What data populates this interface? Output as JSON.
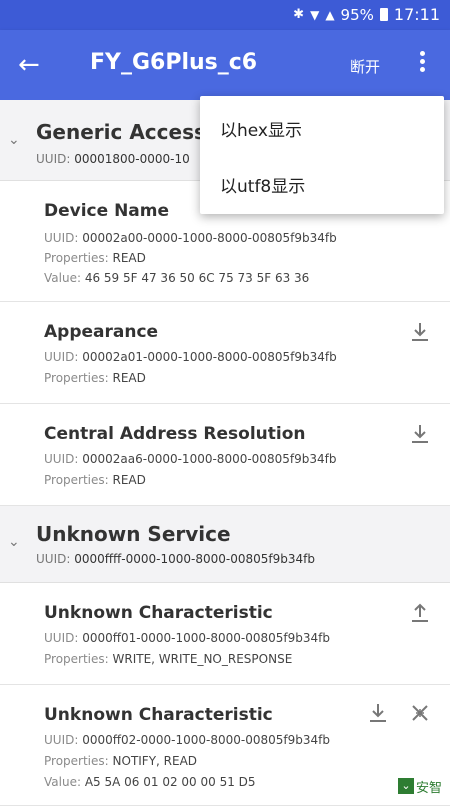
{
  "status_bar": {
    "battery": "95%",
    "time": "17:11"
  },
  "app_bar": {
    "title": "FY_G6Plus_c6",
    "disconnect_label": "断开"
  },
  "overflow_menu": {
    "items": [
      "以hex显示",
      "以utf8显示"
    ]
  },
  "labels": {
    "uuid": "UUID:",
    "properties": "Properties:",
    "value": "Value:"
  },
  "services": [
    {
      "name": "Generic Access",
      "uuid": "00001800-0000-10",
      "characteristics": [
        {
          "name": "Device Name",
          "uuid": "00002a00-0000-1000-8000-00805f9b34fb",
          "properties": "READ",
          "value": "46 59 5F 47 36 50 6C 75 73 5F 63 36"
        },
        {
          "name": "Appearance",
          "uuid": "00002a01-0000-1000-8000-00805f9b34fb",
          "properties": "READ"
        },
        {
          "name": "Central Address Resolution",
          "uuid": "00002aa6-0000-1000-8000-00805f9b34fb",
          "properties": "READ"
        }
      ]
    },
    {
      "name": "Unknown Service",
      "uuid": "0000ffff-0000-1000-8000-00805f9b34fb",
      "characteristics": [
        {
          "name": "Unknown Characteristic",
          "uuid": "0000ff01-0000-1000-8000-00805f9b34fb",
          "properties": "WRITE, WRITE_NO_RESPONSE"
        },
        {
          "name": "Unknown Characteristic",
          "uuid": "0000ff02-0000-1000-8000-00805f9b34fb",
          "properties": "NOTIFY, READ",
          "value": "A5 5A 06 01 02 00 00 51 D5"
        }
      ]
    }
  ],
  "watermark": {
    "text": "安智"
  },
  "icons": {
    "read": "download-icon",
    "write": "upload-icon",
    "notify": "notify-off-icon"
  },
  "colors": {
    "app_bar": "#4a69e0",
    "status_bar": "#3d5bd6",
    "service_bg": "#f3f3f5"
  }
}
